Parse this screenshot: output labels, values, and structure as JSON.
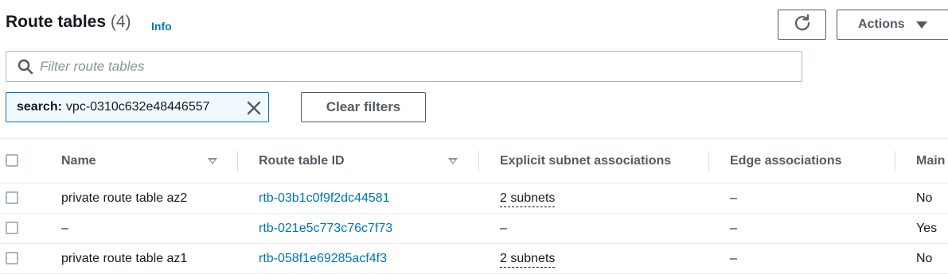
{
  "header": {
    "title": "Route tables",
    "count": "(4)",
    "info_label": "Info",
    "actions_label": "Actions"
  },
  "search": {
    "placeholder": "Filter route tables",
    "value": ""
  },
  "filter_token": {
    "key": "search:",
    "value": "vpc-0310c632e48446557"
  },
  "clear_filters_label": "Clear filters",
  "table": {
    "columns": [
      "Name",
      "Route table ID",
      "Explicit subnet associations",
      "Edge associations",
      "Main"
    ],
    "rows": [
      {
        "name": "private route table az2",
        "id": "rtb-03b1c0f9f2dc44581",
        "subnets": "2 subnets",
        "edge": "–",
        "main": "No"
      },
      {
        "name": "–",
        "id": "rtb-021e5c773c76c7f73",
        "subnets": "–",
        "edge": "–",
        "main": "Yes"
      },
      {
        "name": "private route table az1",
        "id": "rtb-058f1e69285acf4f3",
        "subnets": "2 subnets",
        "edge": "–",
        "main": "No"
      }
    ]
  },
  "colors": {
    "link": "#0073bb",
    "token_bg": "#f1faff",
    "border": "#aab7b8",
    "text": "#16191f",
    "muted": "#545b64"
  }
}
